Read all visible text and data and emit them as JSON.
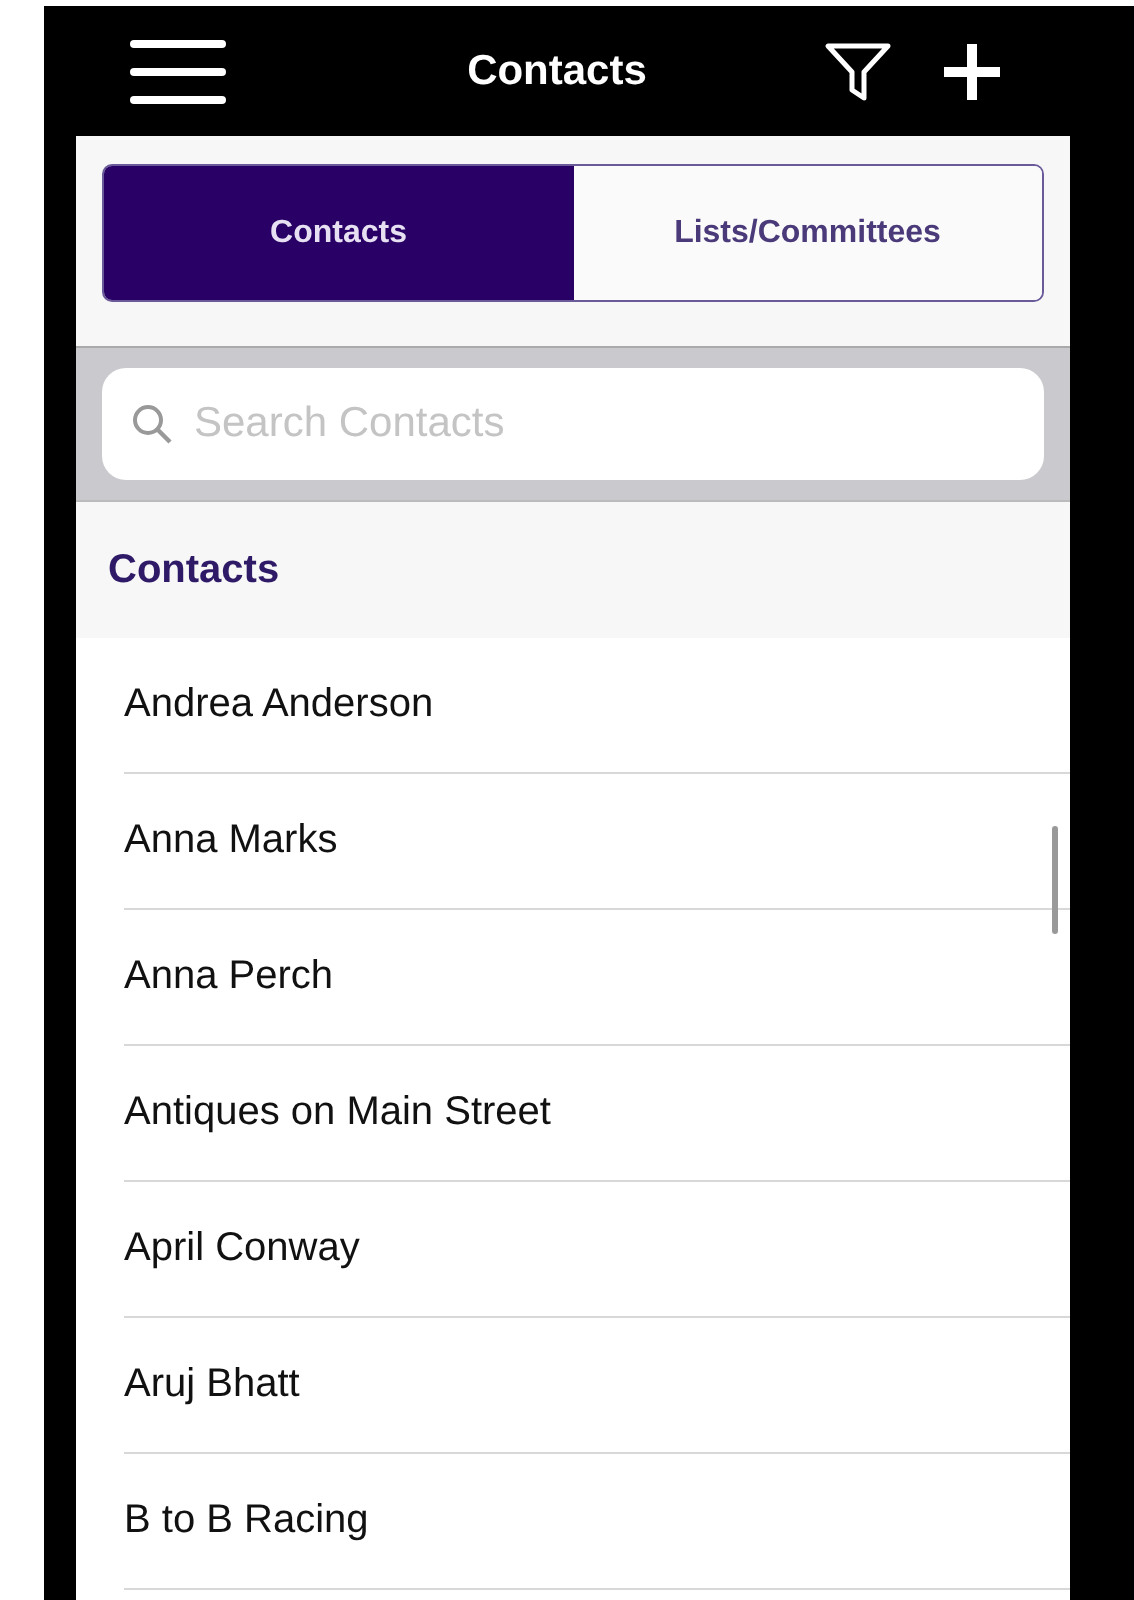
{
  "header": {
    "title": "Contacts"
  },
  "tabs": [
    {
      "label": "Contacts",
      "selected": true
    },
    {
      "label": "Lists/Committees",
      "selected": false
    }
  ],
  "search": {
    "placeholder": "Search Contacts"
  },
  "section": {
    "title": "Contacts"
  },
  "contacts": [
    "Andrea Anderson",
    "Anna Marks",
    "Anna Perch",
    "Antiques on Main Street",
    "April Conway",
    "Aruj Bhatt",
    "B to B Racing"
  ]
}
